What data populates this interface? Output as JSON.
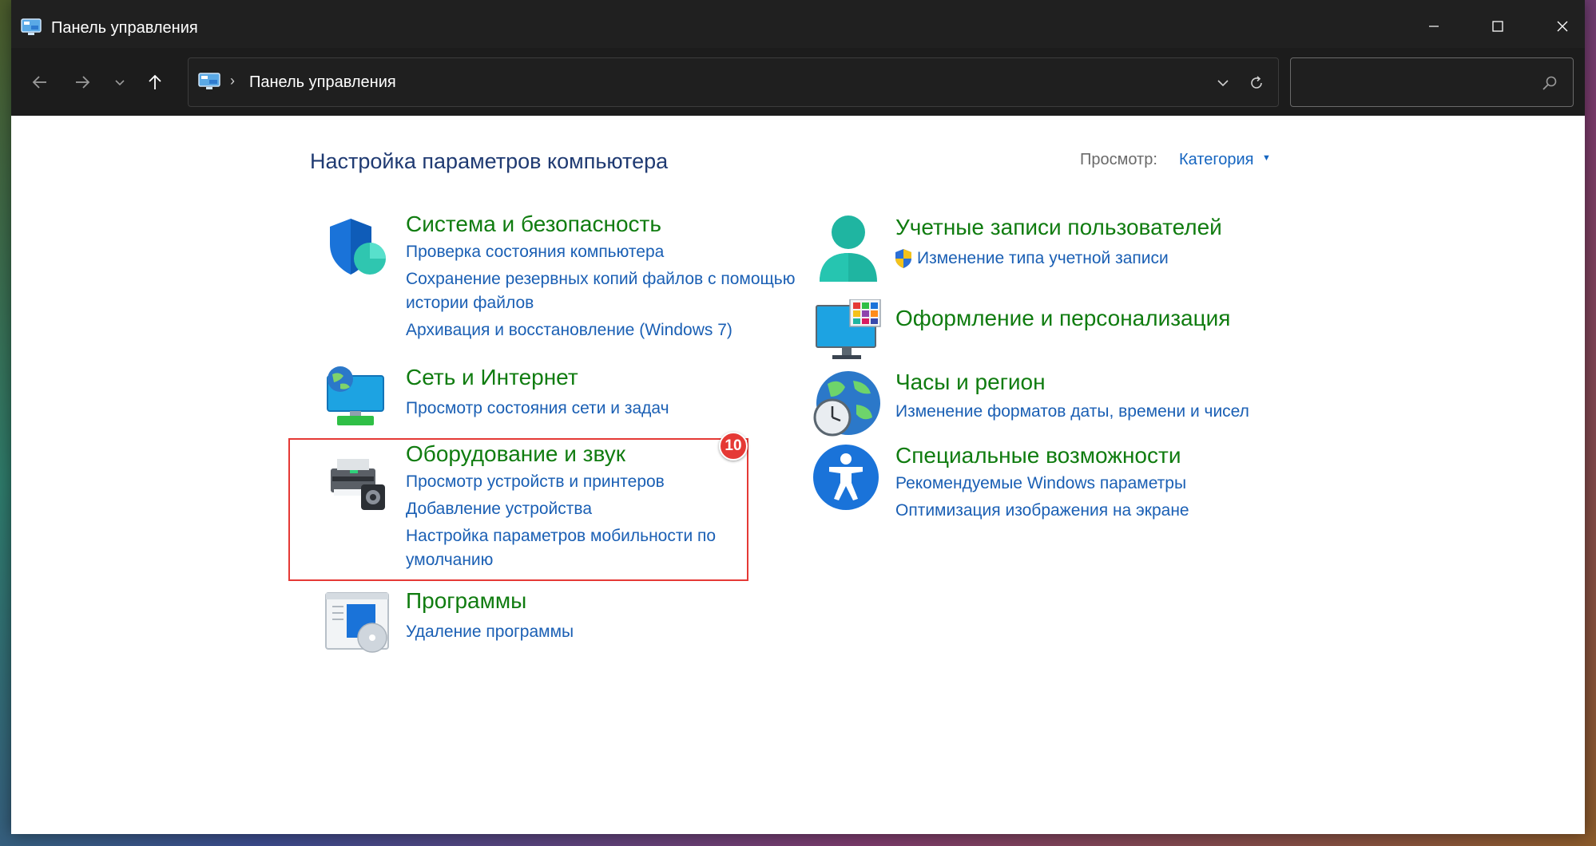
{
  "window": {
    "title": "Панель управления",
    "minimize_icon": "minimize-icon",
    "maximize_icon": "maximize-icon",
    "close_icon": "close-icon"
  },
  "navbar": {
    "back_icon": "arrow-left-icon",
    "forward_icon": "arrow-right-icon",
    "recent_icon": "chevron-down-icon",
    "up_icon": "arrow-up-icon",
    "breadcrumb_sep": "›",
    "breadcrumb": "Панель управления",
    "search_placeholder": ""
  },
  "header": {
    "title": "Настройка параметров компьютера",
    "view_label": "Просмотр:",
    "view_value": "Категория"
  },
  "categories": [
    {
      "title": "Система и безопасность",
      "icon": "shield-icon",
      "links": [
        "Проверка состояния компьютера",
        "Сохранение резервных копий файлов с помощью истории файлов",
        "Архивация и восстановление (Windows 7)"
      ]
    },
    {
      "title": "Сеть и Интернет",
      "icon": "network-globe-icon",
      "links": [
        "Просмотр состояния сети и задач"
      ]
    },
    {
      "title": "Оборудование и звук",
      "icon": "printer-icon",
      "links": [
        "Просмотр устройств и принтеров",
        "Добавление устройства",
        "Настройка параметров мобильности по умолчанию"
      ]
    },
    {
      "title": "Программы",
      "icon": "programs-disc-icon",
      "links": [
        "Удаление программы"
      ]
    },
    {
      "title": "Учетные записи пользователей",
      "icon": "user-icon",
      "links": [
        "Изменение типа учетной записи"
      ]
    },
    {
      "title": "Оформление и персонализация",
      "icon": "monitor-personalization-icon",
      "links": []
    },
    {
      "title": "Часы и регион",
      "icon": "globe-clock-icon",
      "links": [
        "Изменение форматов даты, времени и чисел"
      ]
    },
    {
      "title": "Специальные возможности",
      "icon": "accessibility-icon",
      "links": [
        "Рекомендуемые Windows параметры",
        "Оптимизация изображения на экране"
      ]
    }
  ],
  "annotation": {
    "badge": "10",
    "color": "#e53935"
  },
  "colors": {
    "title_green": "#107c10",
    "link_blue": "#1a5fb4",
    "heading_blue": "#1f3a72",
    "titlebar_bg": "#202020"
  }
}
